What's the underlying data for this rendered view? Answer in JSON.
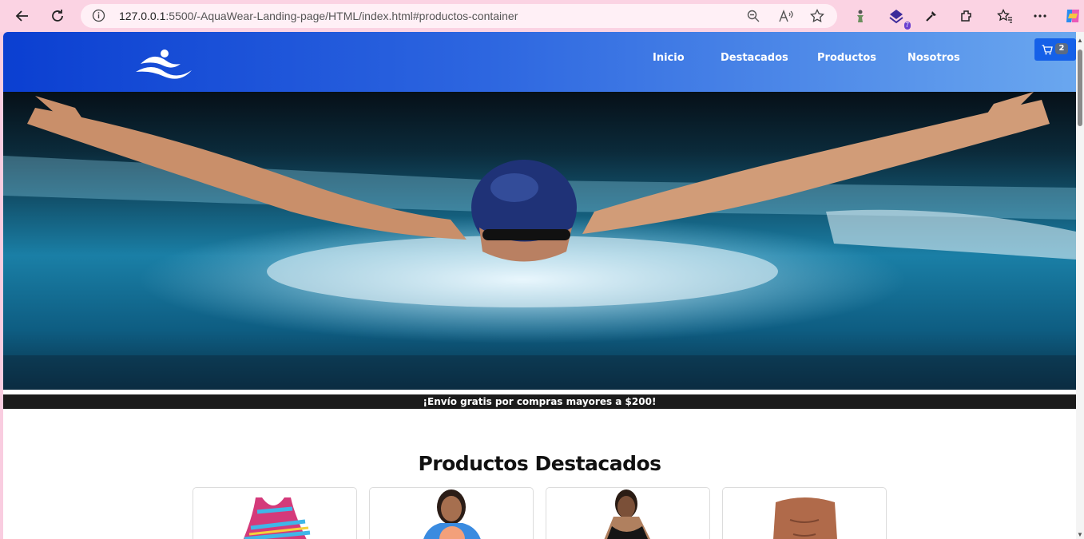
{
  "browser": {
    "url_host": "127.0.0.1",
    "url_rest": ":5500/-AquaWear-Landing-page/HTML/index.html#productos-container",
    "extension_badge": "7",
    "icons": [
      "back-icon",
      "refresh-icon",
      "info-icon",
      "zoom-icon",
      "read-aloud-icon",
      "favorite-star-icon",
      "extension-figure-icon",
      "extension-shield-icon",
      "eyedropper-icon",
      "extensions-icon",
      "favorites-icon",
      "more-icon",
      "copilot-icon"
    ]
  },
  "header": {
    "nav": [
      {
        "label": "Inicio"
      },
      {
        "label": "Destacados"
      },
      {
        "label": "Productos"
      },
      {
        "label": "Nosotros"
      }
    ],
    "cart_count": "2",
    "colors": {
      "header_start": "#0b3fd1",
      "header_end": "#6aa7ef",
      "cart": "#1560e8"
    }
  },
  "promo": {
    "text": "¡Envío gratis por compras mayores a $200!"
  },
  "featured": {
    "title": "Productos Destacados",
    "products": [
      {
        "image": "swimsuit-striped"
      },
      {
        "image": "rashguard-kid"
      },
      {
        "image": "swimsuit-black"
      },
      {
        "image": "swim-trunks"
      }
    ]
  }
}
